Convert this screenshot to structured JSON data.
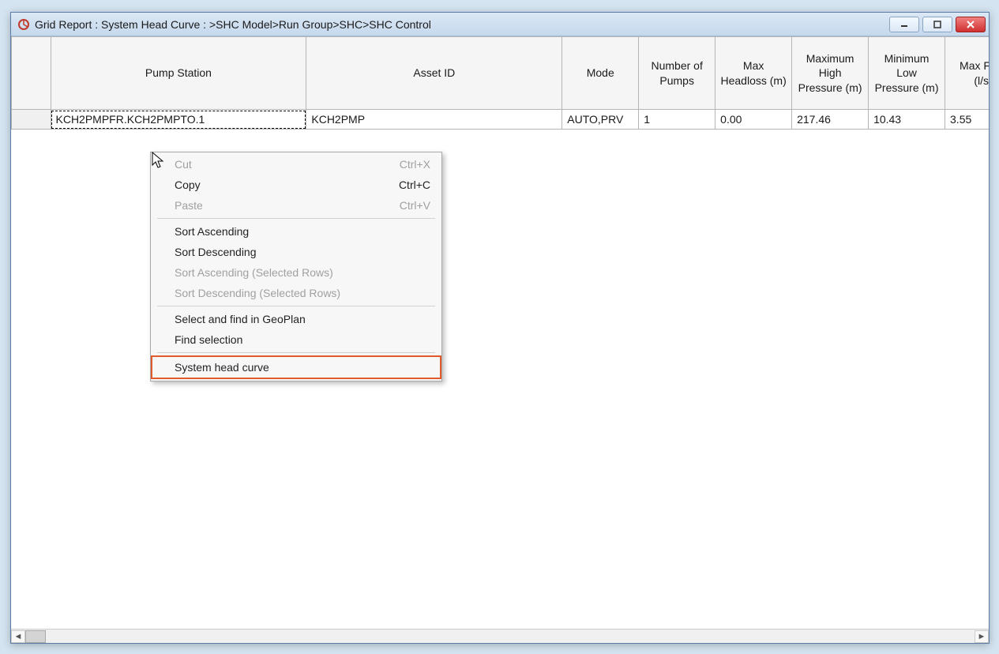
{
  "window": {
    "title": "Grid Report : System Head Curve : >SHC Model>Run Group>SHC>SHC Control"
  },
  "columns": {
    "c0": "",
    "c1": "Pump Station",
    "c2": "Asset ID",
    "c3": "Mode",
    "c4": "Number of Pumps",
    "c5": "Max Headloss (m)",
    "c6": "Maximum High Pressure (m)",
    "c7": "Minimum Low Pressure (m)",
    "c8": "Max Flow (l/s)"
  },
  "rows": [
    {
      "pump_station": "KCH2PMPFR.KCH2PMPTO.1",
      "asset_id": "KCH2PMP",
      "mode": "AUTO,PRV",
      "num_pumps": "1",
      "max_headloss": "0.00",
      "max_high_pressure": "217.46",
      "min_low_pressure": "10.43",
      "max_flow": "3.55"
    }
  ],
  "context_menu": {
    "cut": {
      "label": "Cut",
      "shortcut": "Ctrl+X"
    },
    "copy": {
      "label": "Copy",
      "shortcut": "Ctrl+C"
    },
    "paste": {
      "label": "Paste",
      "shortcut": "Ctrl+V"
    },
    "sort_asc": {
      "label": "Sort Ascending"
    },
    "sort_desc": {
      "label": "Sort Descending"
    },
    "sort_asc_sel": {
      "label": "Sort Ascending (Selected Rows)"
    },
    "sort_desc_sel": {
      "label": "Sort Descending (Selected Rows)"
    },
    "select_find_geoplan": {
      "label": "Select and find in GeoPlan"
    },
    "find_selection": {
      "label": "Find selection"
    },
    "system_head_curve": {
      "label": "System head curve"
    }
  }
}
